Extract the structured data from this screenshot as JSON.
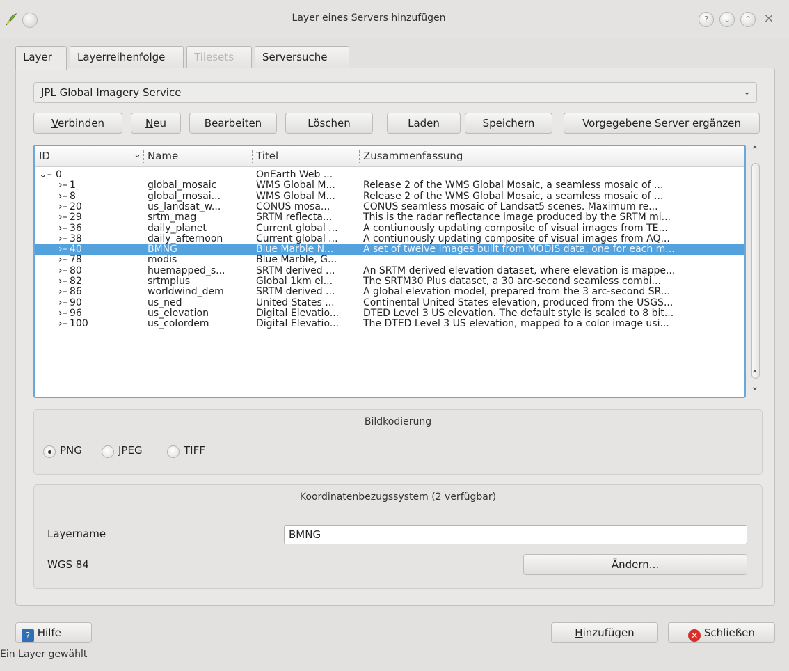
{
  "window": {
    "title": "Layer eines Servers hinzufügen",
    "help_glyph": "?",
    "min_glyph": "⌄",
    "max_glyph": "⌃",
    "close_glyph": "×"
  },
  "tabs": [
    {
      "label": "Layer",
      "active": true
    },
    {
      "label": "Layerreihenfolge",
      "active": false
    },
    {
      "label": "Tilesets",
      "disabled": true
    },
    {
      "label": "Serversuche",
      "active": false
    }
  ],
  "server_combo": {
    "value": "JPL Global Imagery Service",
    "arrow": "⌄"
  },
  "buttons": {
    "connect_u": "V",
    "connect_rest": "erbinden",
    "new_u": "N",
    "new_rest": "eu",
    "edit": "Bearbeiten",
    "delete": "Löschen",
    "load": "Laden",
    "save": "Speichern",
    "add_default": "Vorgegebene Server ergänzen"
  },
  "tree": {
    "columns": [
      "ID",
      "Name",
      "Titel",
      "Zusammenfassung"
    ],
    "sort_arrow": "⌄",
    "root": {
      "id": "0",
      "title": "OnEarth Web ..."
    },
    "rows": [
      {
        "id": "1",
        "name": "global_mosaic",
        "title": "WMS Global M...",
        "summary": "Release 2 of the WMS Global Mosaic, a seamless mosaic of ..."
      },
      {
        "id": "8",
        "name": "global_mosai...",
        "title": "WMS Global M...",
        "summary": "Release 2 of the WMS Global Mosaic, a seamless mosaic of ..."
      },
      {
        "id": "20",
        "name": "us_landsat_w...",
        "title": "CONUS mosa...",
        "summary": "CONUS seamless mosaic of Landsat5 scenes. Maximum re..."
      },
      {
        "id": "29",
        "name": "srtm_mag",
        "title": "SRTM reflecta...",
        "summary": "This is the radar reflectance image produced by the SRTM mi..."
      },
      {
        "id": "36",
        "name": "daily_planet",
        "title": "Current global ...",
        "summary": "A contiunously updating composite of visual images from TE..."
      },
      {
        "id": "38",
        "name": "daily_afternoon",
        "title": "Current global ...",
        "summary": "A contiunously updating composite of visual images from AQ..."
      },
      {
        "id": "40",
        "name": "BMNG",
        "title": "Blue Marble N...",
        "summary": "A set of twelve images built from MODIS data, one for each m..."
      },
      {
        "id": "78",
        "name": "modis",
        "title": "Blue Marble, G...",
        "summary": ""
      },
      {
        "id": "80",
        "name": "huemapped_s...",
        "title": "SRTM derived ...",
        "summary": "An SRTM derived elevation dataset, where elevation is mappe..."
      },
      {
        "id": "82",
        "name": "srtmplus",
        "title": "Global 1km el...",
        "summary": "The SRTM30 Plus dataset, a 30 arc-second seamless combi..."
      },
      {
        "id": "86",
        "name": "worldwind_dem",
        "title": "SRTM derived ...",
        "summary": "A global elevation model, prepared from the 3 arc-second SR..."
      },
      {
        "id": "90",
        "name": "us_ned",
        "title": "United States ...",
        "summary": "Continental United States elevation, produced from the USGS..."
      },
      {
        "id": "96",
        "name": "us_elevation",
        "title": "Digital Elevatio...",
        "summary": "DTED Level 3 US elevation. The default style is scaled to 8 bit..."
      },
      {
        "id": "100",
        "name": "us_colordem",
        "title": "Digital Elevatio...",
        "summary": "The DTED Level 3 US elevation, mapped to a color image usi..."
      }
    ]
  },
  "encoding": {
    "title": "Bildkodierung",
    "options": [
      "PNG",
      "JPEG",
      "TIFF"
    ],
    "selected": "PNG"
  },
  "crs": {
    "title": "Koordinatenbezugssystem (2 verfügbar)",
    "layername_label": "Layername",
    "layername_value": "BMNG",
    "crs_label": "WGS 84",
    "change_button": "Ändern..."
  },
  "bottom": {
    "help": "Hilfe",
    "add_u": "H",
    "add_rest": "inzufügen",
    "close": "Schließen",
    "status": "Ein Layer gewählt"
  },
  "colors": {
    "selection": "#54a2dd",
    "focus_border": "#6aa8dc"
  }
}
